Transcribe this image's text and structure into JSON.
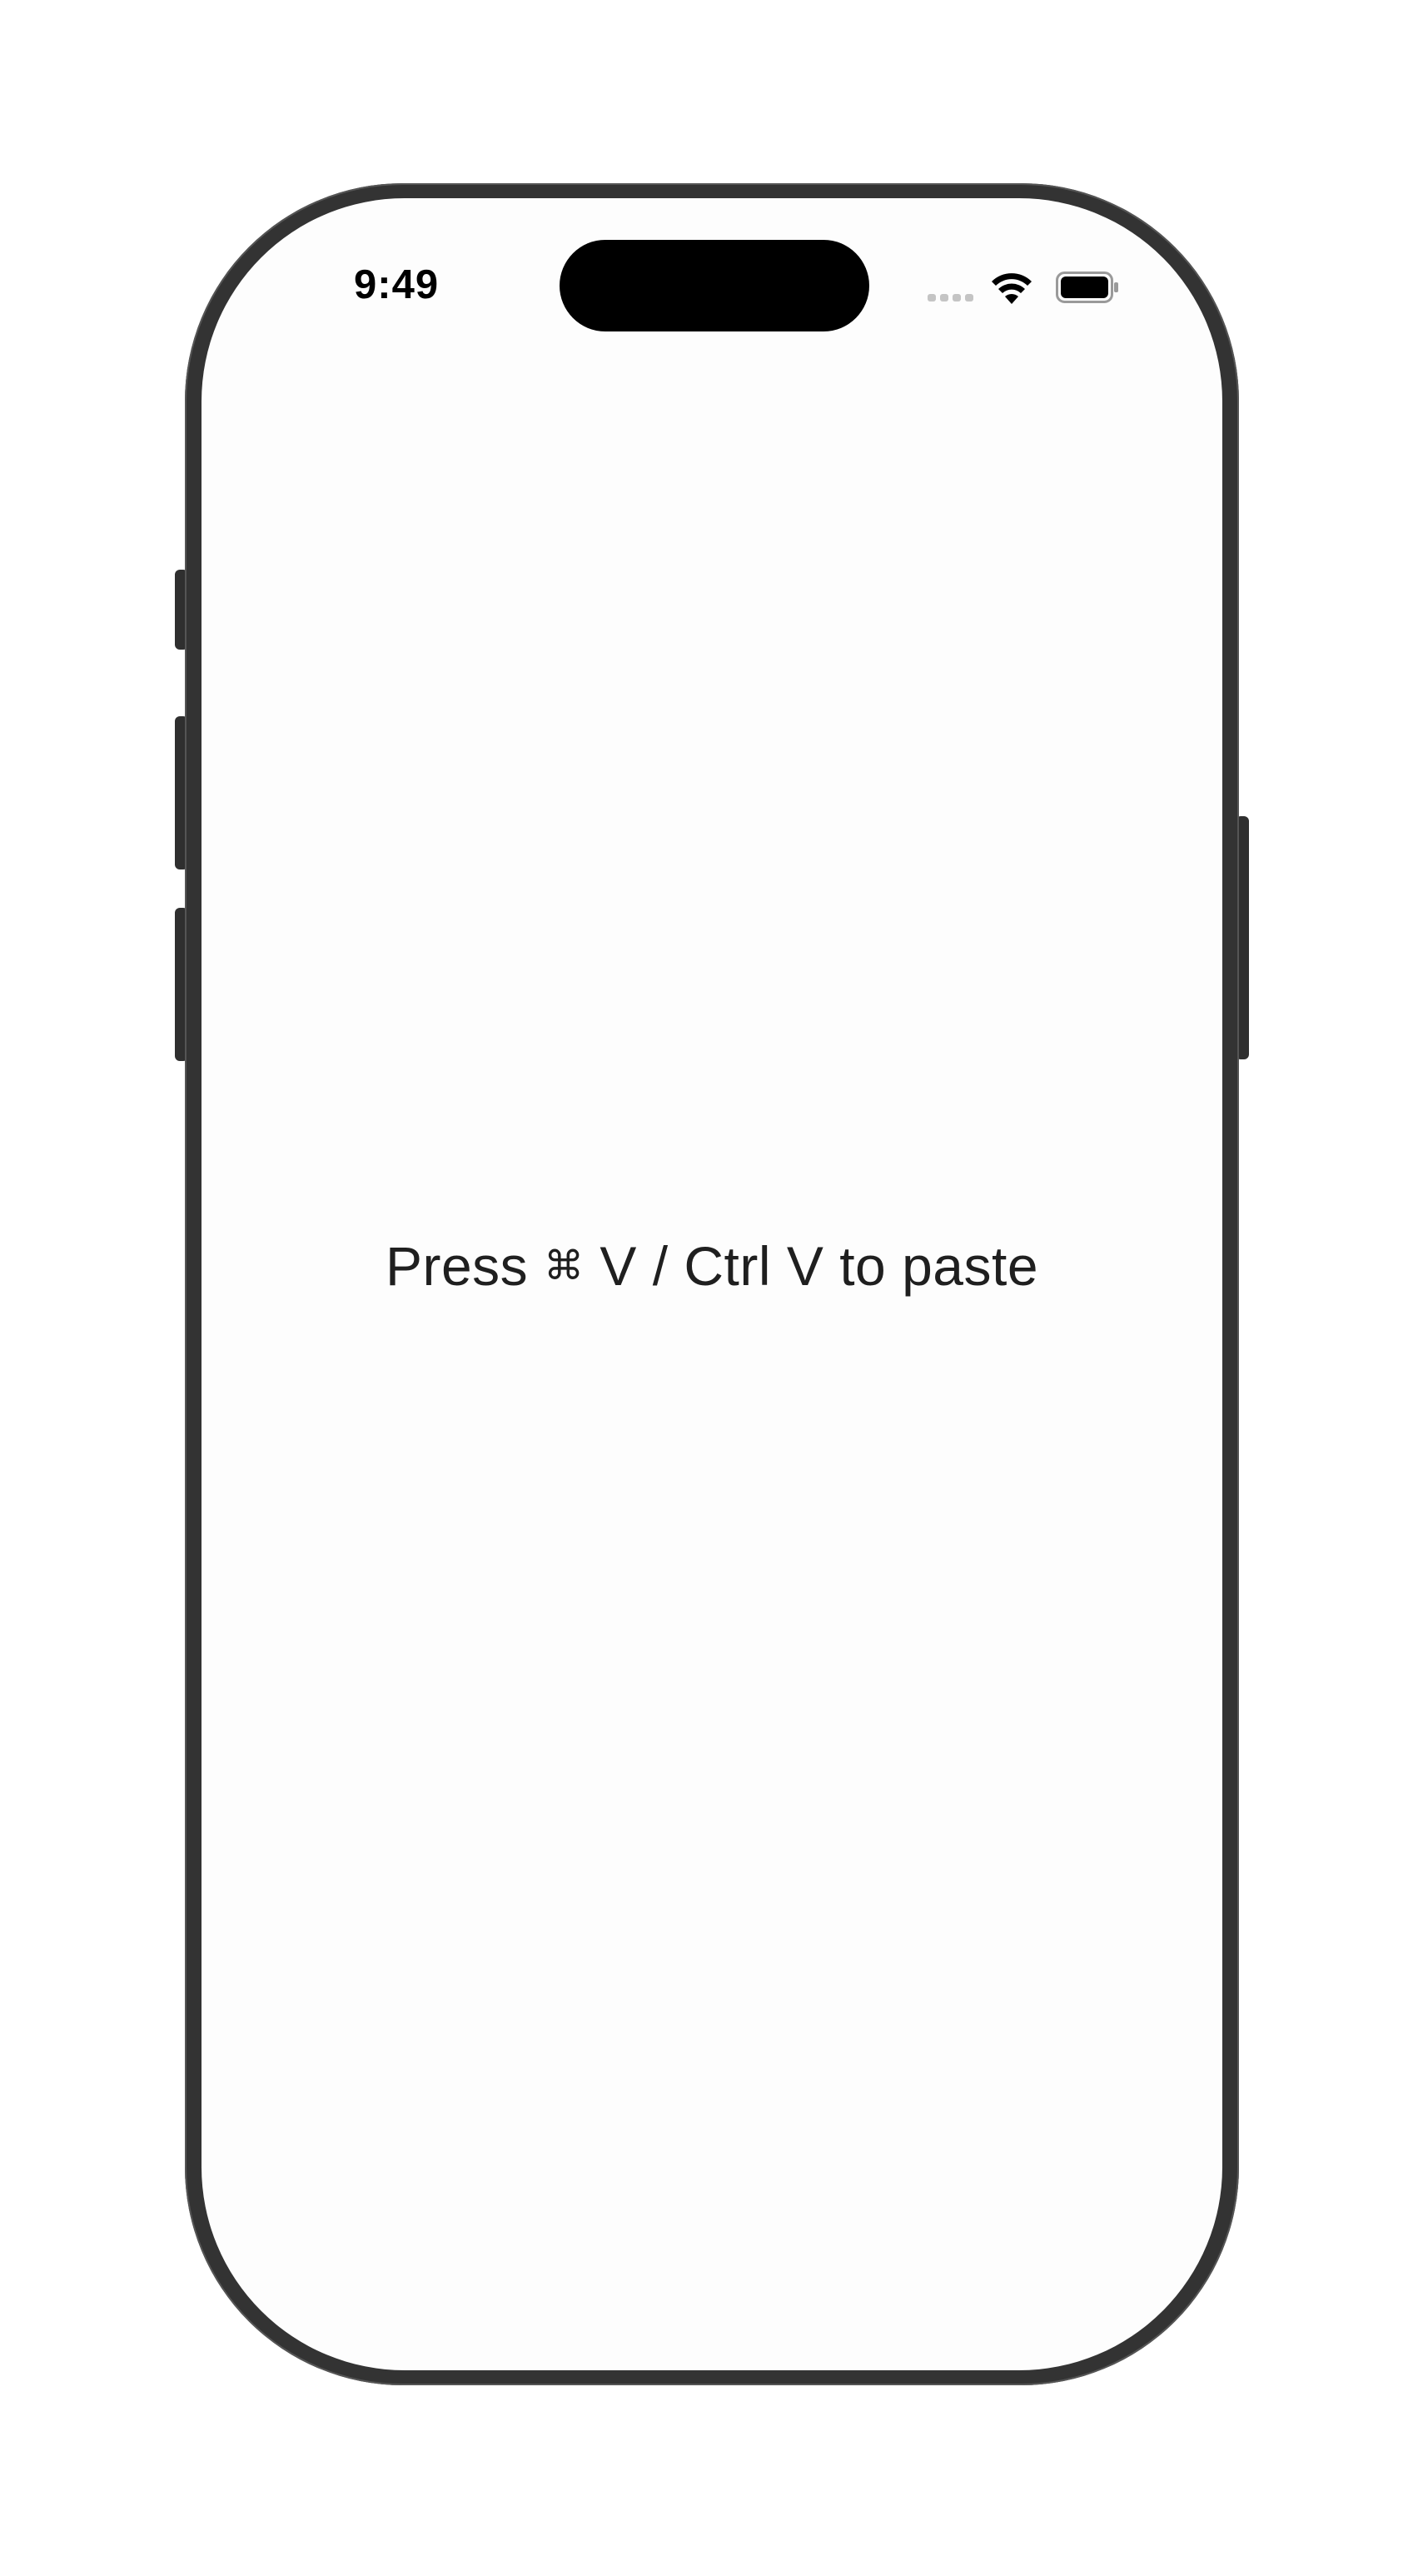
{
  "status_bar": {
    "time": "9:49",
    "icons": [
      "cellular-signal-icon",
      "wifi-icon",
      "battery-icon"
    ]
  },
  "main": {
    "hint_prefix": "Press",
    "hint_command_symbol": "⌘",
    "hint_suffix": "V / Ctrl V to paste"
  },
  "colors": {
    "frame": "#333333",
    "screen_background": "#fdfdfd",
    "text": "#1f1f1f",
    "dynamic_island": "#000000"
  }
}
